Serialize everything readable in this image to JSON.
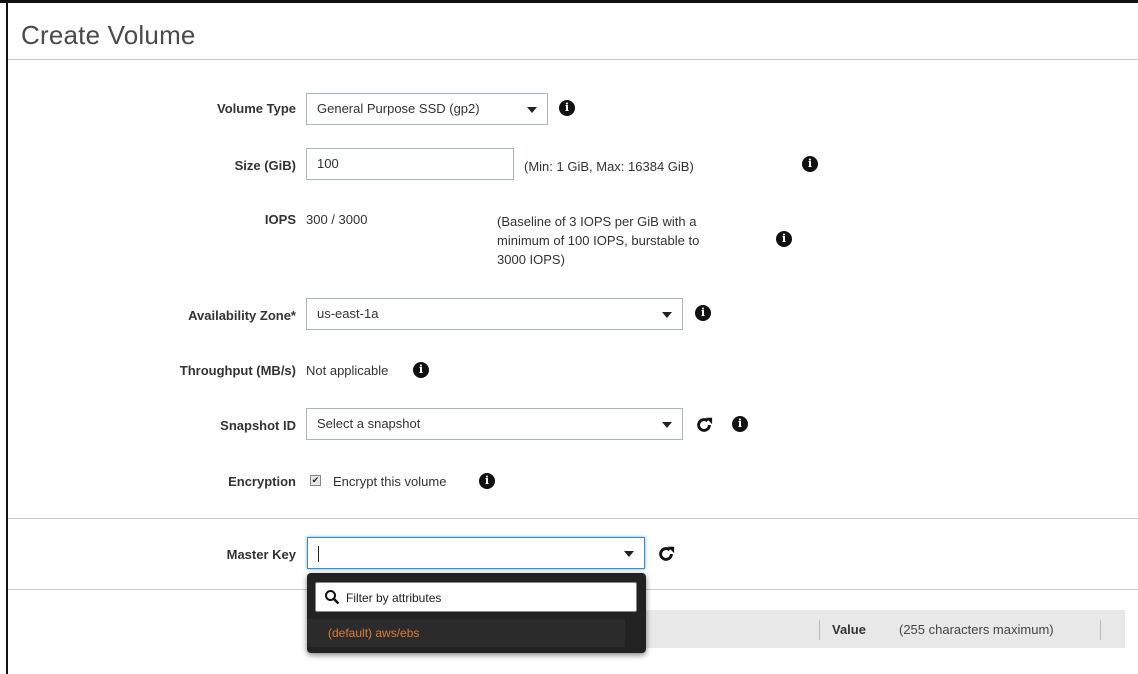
{
  "page": {
    "title": "Create Volume"
  },
  "form": {
    "volume_type": {
      "label": "Volume Type",
      "value": "General Purpose SSD (gp2)"
    },
    "size": {
      "label": "Size (GiB)",
      "value": "100",
      "hint": "(Min: 1 GiB, Max: 16384 GiB)"
    },
    "iops": {
      "label": "IOPS",
      "value": "300 / 3000",
      "hint_lines": [
        "(Baseline of 3 IOPS per GiB with a",
        "minimum of 100 IOPS, burstable to",
        "3000 IOPS)"
      ]
    },
    "availability_zone": {
      "label": "Availability Zone*",
      "value": "us-east-1a"
    },
    "throughput": {
      "label": "Throughput (MB/s)",
      "value": "Not applicable"
    },
    "snapshot_id": {
      "label": "Snapshot ID",
      "placeholder": "Select a snapshot"
    },
    "encryption": {
      "label": "Encryption",
      "checkbox_label": "Encrypt this volume",
      "checked": true
    },
    "master_key": {
      "label": "Master Key",
      "value": ""
    }
  },
  "dropdown": {
    "filter_placeholder": "Filter by attributes",
    "options": [
      "(default) aws/ebs"
    ]
  },
  "tags_table": {
    "value_header": "Value",
    "value_hint": "(255 characters maximum)"
  },
  "icons": {
    "info": "info-icon",
    "refresh": "refresh-icon",
    "caret": "chevron-down-icon",
    "search": "search-icon"
  },
  "colors": {
    "accent_orange": "#e07b39",
    "focus_blue": "#3f8ac7",
    "dropdown_bg": "#222222"
  }
}
